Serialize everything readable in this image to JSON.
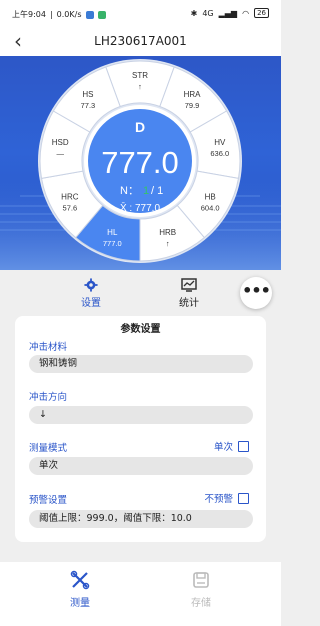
{
  "status_bar": {
    "time": "上午9:04",
    "speed": "0.0K/s",
    "network": "4G",
    "battery": "26"
  },
  "header": {
    "title": "LH230617A001",
    "back_icon": "chevron-left-icon"
  },
  "dial": {
    "center_label": "D",
    "main_value": "777.0",
    "n_label": "N：",
    "n_value": "1",
    "n_total": "/ 1",
    "avg_label": "X̄ : 777.0",
    "segments": [
      {
        "name": "STR",
        "value": "↑"
      },
      {
        "name": "HRA",
        "value": "79.9"
      },
      {
        "name": "HV",
        "value": "636.0"
      },
      {
        "name": "HB",
        "value": "604.0"
      },
      {
        "name": "HRB",
        "value": "↑"
      },
      {
        "name": "HL",
        "value": "777.0"
      },
      {
        "name": "HRC",
        "value": "57.6"
      },
      {
        "name": "HSD",
        "value": "—"
      },
      {
        "name": "HS",
        "value": "77.3"
      }
    ],
    "colors": {
      "accent": "#4a86f0",
      "green": "#36c46b",
      "bg": "#2d5fd2"
    }
  },
  "tabs": [
    {
      "label": "设置",
      "icon": "gear-icon",
      "active": true
    },
    {
      "label": "统计",
      "icon": "chart-icon",
      "active": false
    }
  ],
  "more_label": "•••",
  "settings": {
    "title": "参数设置",
    "material_label": "冲击材料",
    "material_value": "钢和铸钢",
    "direction_label": "冲击方向",
    "direction_value": "↓",
    "mode_label": "测量模式",
    "mode_check_label": "单次",
    "mode_value": "单次",
    "alarm_label": "预警设置",
    "alarm_check_label": "不预警",
    "alarm_value": "阈值上限：999.0，阈值下限：10.0"
  },
  "bottom_nav": [
    {
      "label": "测量",
      "icon": "measure-icon",
      "active": true
    },
    {
      "label": "存储",
      "icon": "save-icon",
      "active": false
    }
  ]
}
